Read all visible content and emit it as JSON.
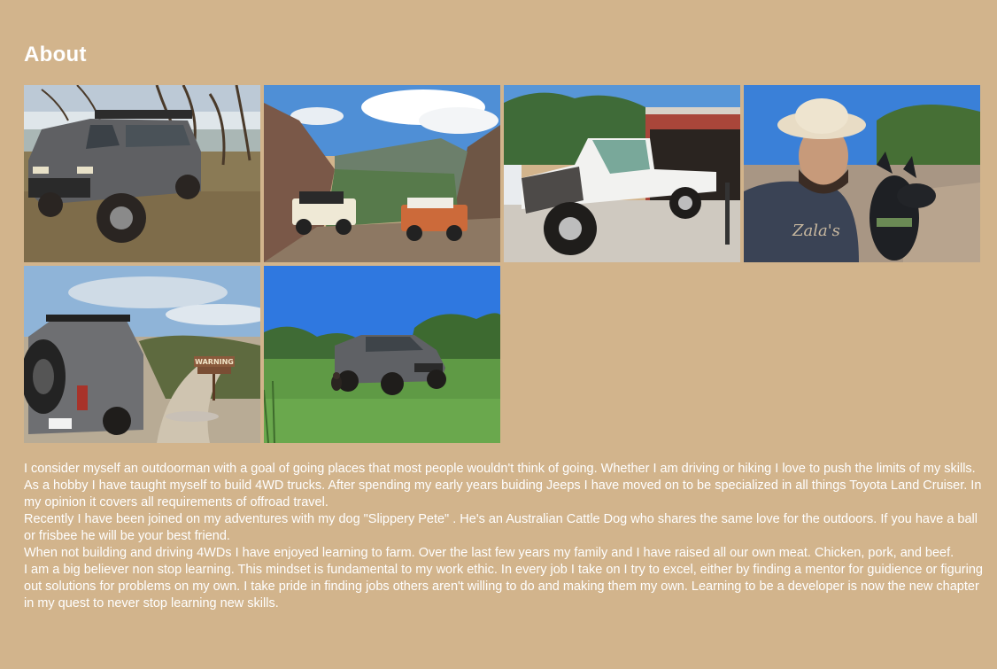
{
  "about": {
    "title": "About",
    "paragraphs": [
      "I consider myself an outdoorman with a goal of going places that most people wouldn't think of going. Whether I am driving or hiking I love to push the limits of my skills.",
      "As a hobby I have taught myself to build 4WD trucks. After spending my early years buiding Jeeps I have moved on to be specialized in all things Toyota Land Cruiser. In my opinion it covers all requirements of offroad travel.",
      "Recently I have been joined on my adventures with my dog \"Slippery Pete\" . He's an Australian Cattle Dog who shares the same love for the outdoors. If you have a ball or frisbee he will be your best friend.",
      "When not building and driving 4WDs I have enjoyed learning to farm. Over the last few years my family and I have raised all our own meat. Chicken, pork, and beef.",
      "I am a big believer non stop learning. This mindset is fundamental to my work ethic. In every job I take on I try to excel, either by finding a mentor for guidience or figuring out solutions for problems on my own. I take pride in finding jobs others aren't willing to do and making them my own. Learning to be a developer is now the new chapter in my quest to never stop learning new skills."
    ],
    "photos": [
      {
        "subject": "land-cruiser-by-lake"
      },
      {
        "subject": "two-land-cruisers-mountain-overlook"
      },
      {
        "subject": "fj45-pickup-build-in-garage"
      },
      {
        "subject": "selfie-with-cowboy-hat-and-dog"
      },
      {
        "subject": "land-cruiser-at-warning-sign-trail",
        "sign_text": "WARNING"
      },
      {
        "subject": "land-cruiser-on-green-field-with-dog"
      }
    ]
  }
}
